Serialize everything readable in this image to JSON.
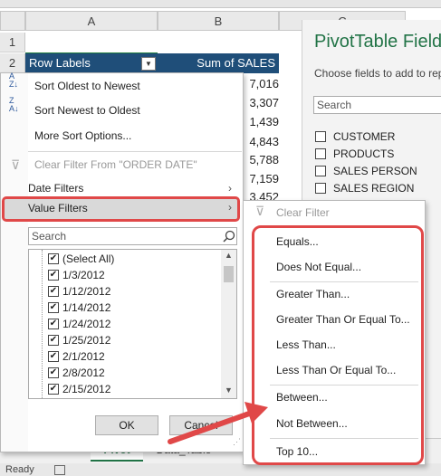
{
  "spreadsheet": {
    "column_a": "A",
    "column_b": "B",
    "column_c": "C",
    "row_numbers": [
      "1",
      "2"
    ],
    "header": {
      "row_labels": "Row Labels",
      "sum_of_sales": "Sum of SALES"
    },
    "values": [
      "7,016",
      "3,307",
      "1,439",
      "4,843",
      "5,788",
      "7,159",
      "3,452"
    ]
  },
  "filter_menu": {
    "sort_oldest": "Sort Oldest to Newest",
    "sort_newest": "Sort Newest to Oldest",
    "more_sort": "More Sort Options...",
    "clear_filter": "Clear Filter From \"ORDER DATE\"",
    "date_filters": "Date Filters",
    "value_filters": "Value Filters",
    "search_placeholder": "Search",
    "items": [
      "(Select All)",
      "1/3/2012",
      "1/12/2012",
      "1/14/2012",
      "1/24/2012",
      "1/25/2012",
      "2/1/2012",
      "2/8/2012",
      "2/15/2012"
    ],
    "ok": "OK",
    "cancel": "Cancel"
  },
  "pivot_pane": {
    "title": "PivotTable Fields",
    "subtitle": "Choose fields to add to report:",
    "search_placeholder": "Search",
    "fields": [
      "CUSTOMER",
      "PRODUCTS",
      "SALES PERSON",
      "SALES REGION"
    ]
  },
  "value_filters_menu": {
    "clear_filter": "Clear Filter",
    "items": [
      "Equals...",
      "Does Not Equal...",
      "Greater Than...",
      "Greater Than Or Equal To...",
      "Less Than...",
      "Less Than Or Equal To...",
      "Between...",
      "Not Between...",
      "Top 10..."
    ]
  },
  "sheet_tabs": [
    "Pivot",
    "Data_Table"
  ],
  "status": {
    "ready": "Ready"
  },
  "colors": {
    "header_fill": "#1f4e79",
    "highlight_red": "#e04848",
    "pane_bg": "#f3f3f3",
    "pane_title": "#217346"
  }
}
